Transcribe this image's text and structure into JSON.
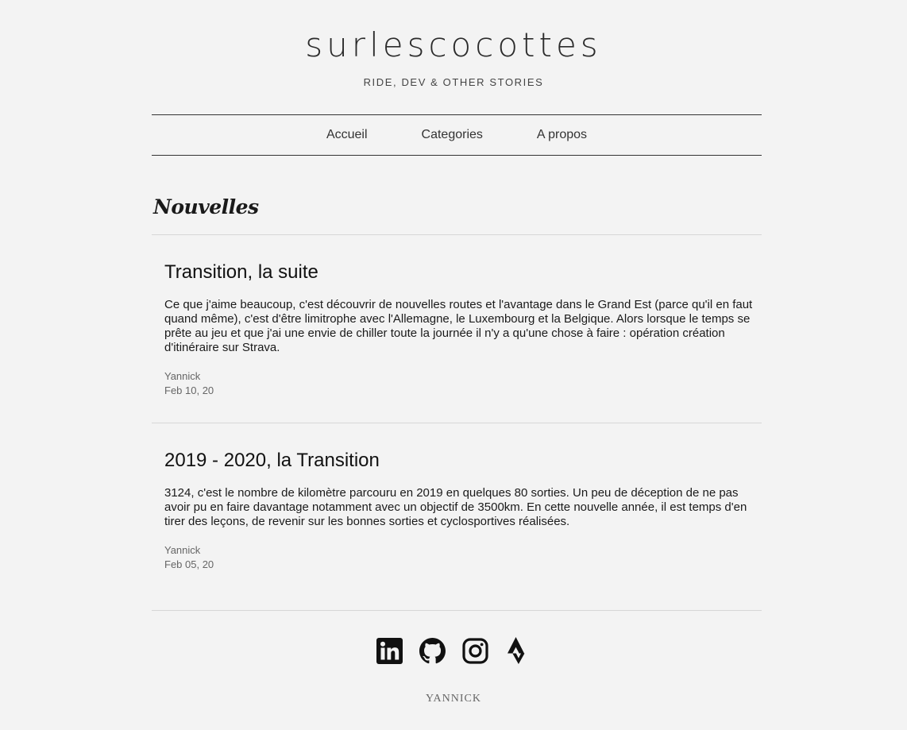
{
  "site": {
    "title": "surlescocottes",
    "tagline": "RIDE, DEV & OTHER STORIES"
  },
  "nav": {
    "items": [
      {
        "label": "Accueil"
      },
      {
        "label": "Categories"
      },
      {
        "label": "A propos"
      }
    ]
  },
  "section": {
    "title": "Nouvelles"
  },
  "posts": [
    {
      "title": "Transition, la suite",
      "excerpt": "Ce que j'aime beaucoup, c'est découvrir de nouvelles routes et l'avantage dans le Grand Est (parce qu'il en faut quand même), c'est d'être limitrophe avec l'Allemagne, le Luxembourg et la Belgique. Alors lorsque le temps se prête au jeu et que j'ai une envie de chiller toute la journée il n'y a qu'une chose à faire : opération création d'itinéraire sur Strava.",
      "author": "Yannick",
      "date": "Feb 10, 20"
    },
    {
      "title": "2019 - 2020, la Transition",
      "excerpt": "3124, c'est le nombre de kilomètre parcouru en 2019 en quelques 80 sorties. Un peu de déception de ne pas avoir pu en faire davantage notamment avec un objectif de 3500km. En cette nouvelle année, il est temps d'en tirer des leçons, de revenir sur les bonnes sorties et cyclosportives réalisées.",
      "author": "Yannick",
      "date": "Feb 05, 20"
    }
  ],
  "social": {
    "icons": [
      "linkedin-icon",
      "github-icon",
      "instagram-icon",
      "strava-icon"
    ]
  },
  "footer": {
    "name": "YANNICK"
  },
  "colors": {
    "background": "#f3f3f3",
    "text": "#1a1a1a",
    "muted": "#666666"
  }
}
